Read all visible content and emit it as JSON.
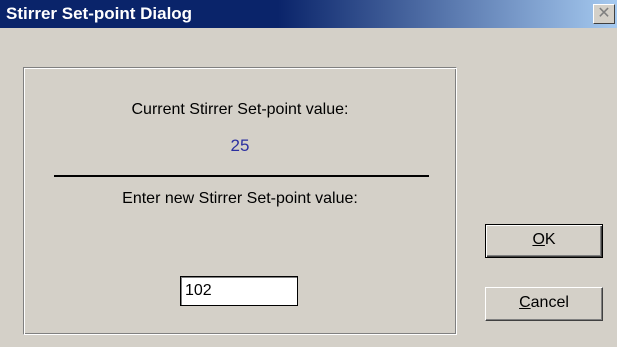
{
  "window": {
    "title": "Stirrer Set-point Dialog",
    "close_glyph": "✕",
    "close_icon": "close-icon"
  },
  "panel": {
    "current_label": "Current Stirrer Set-point value:",
    "current_value": "25",
    "new_label": "Enter new Stirrer Set-point value:",
    "new_value": "102"
  },
  "buttons": {
    "ok_mnemonic": "O",
    "ok_rest": "K",
    "cancel_mnemonic": "C",
    "cancel_rest": "ancel"
  },
  "colors": {
    "titlebar": "#0a246a",
    "dialog_bg": "#d4d0c8",
    "value_text": "#2b2fa0"
  }
}
